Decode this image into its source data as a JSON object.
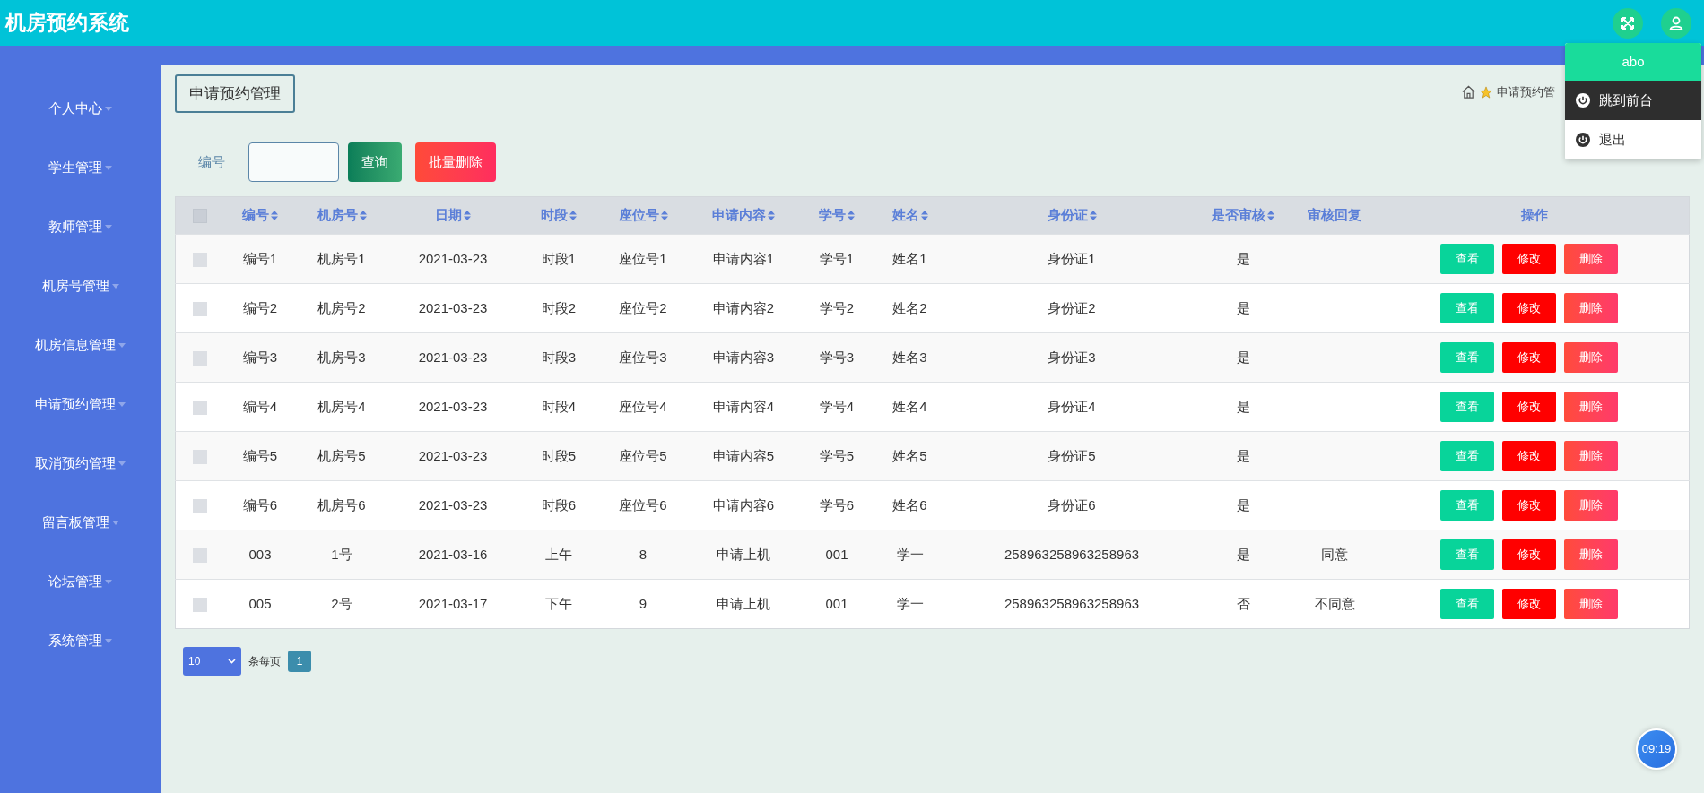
{
  "app_title": "机房预约系统",
  "user_menu": {
    "username": "abo",
    "items": [
      {
        "label": "跳到前台",
        "selected": true
      },
      {
        "label": "退出",
        "selected": false
      }
    ]
  },
  "sidebar": {
    "items": [
      "个人中心",
      "学生管理",
      "教师管理",
      "机房号管理",
      "机房信息管理",
      "申请预约管理",
      "取消预约管理",
      "留言板管理",
      "论坛管理",
      "系统管理"
    ]
  },
  "page_title": "申请预约管理",
  "breadcrumb": "申请预约管",
  "filter": {
    "label": "编号",
    "search_button": "查询",
    "batch_delete_button": "批量删除"
  },
  "table": {
    "select_all_checked": false,
    "columns": [
      {
        "label": "编号",
        "sortable": true
      },
      {
        "label": "机房号",
        "sortable": true
      },
      {
        "label": "日期",
        "sortable": true
      },
      {
        "label": "时段",
        "sortable": true
      },
      {
        "label": "座位号",
        "sortable": true
      },
      {
        "label": "申请内容",
        "sortable": true
      },
      {
        "label": "学号",
        "sortable": true
      },
      {
        "label": "姓名",
        "sortable": true
      },
      {
        "label": "身份证",
        "sortable": true
      },
      {
        "label": "是否审核",
        "sortable": true
      },
      {
        "label": "审核回复",
        "sortable": false
      },
      {
        "label": "操作",
        "sortable": false
      }
    ],
    "rows": [
      {
        "checked": false,
        "cells": [
          "编号1",
          "机房号1",
          "2021-03-23",
          "时段1",
          "座位号1",
          "申请内容1",
          "学号1",
          "姓名1",
          "身份证1",
          "是",
          ""
        ]
      },
      {
        "checked": false,
        "cells": [
          "编号2",
          "机房号2",
          "2021-03-23",
          "时段2",
          "座位号2",
          "申请内容2",
          "学号2",
          "姓名2",
          "身份证2",
          "是",
          ""
        ]
      },
      {
        "checked": false,
        "cells": [
          "编号3",
          "机房号3",
          "2021-03-23",
          "时段3",
          "座位号3",
          "申请内容3",
          "学号3",
          "姓名3",
          "身份证3",
          "是",
          ""
        ]
      },
      {
        "checked": false,
        "cells": [
          "编号4",
          "机房号4",
          "2021-03-23",
          "时段4",
          "座位号4",
          "申请内容4",
          "学号4",
          "姓名4",
          "身份证4",
          "是",
          ""
        ]
      },
      {
        "checked": false,
        "cells": [
          "编号5",
          "机房号5",
          "2021-03-23",
          "时段5",
          "座位号5",
          "申请内容5",
          "学号5",
          "姓名5",
          "身份证5",
          "是",
          ""
        ]
      },
      {
        "checked": false,
        "cells": [
          "编号6",
          "机房号6",
          "2021-03-23",
          "时段6",
          "座位号6",
          "申请内容6",
          "学号6",
          "姓名6",
          "身份证6",
          "是",
          ""
        ]
      },
      {
        "checked": false,
        "cells": [
          "003",
          "1号",
          "2021-03-16",
          "上午",
          "8",
          "申请上机",
          "001",
          "学一",
          "258963258963258963",
          "是",
          "同意"
        ]
      },
      {
        "checked": false,
        "cells": [
          "005",
          "2号",
          "2021-03-17",
          "下午",
          "9",
          "申请上机",
          "001",
          "学一",
          "258963258963258963",
          "否",
          "不同意"
        ]
      }
    ],
    "actions": [
      [
        "查看",
        "修改",
        "删除"
      ],
      [
        "查看",
        "修改",
        "删除"
      ],
      [
        "查看",
        "修改",
        "删除"
      ],
      [
        "查看",
        "修改",
        "删除"
      ],
      [
        "查看",
        "修改",
        "删除"
      ],
      [
        "查看",
        "修改",
        "删除"
      ],
      [
        "查看",
        "修改",
        "删除"
      ],
      [
        "查看",
        "修改",
        "删除"
      ]
    ]
  },
  "pagination": {
    "page_size": "10",
    "page_size_label": "条每页",
    "pages": [
      {
        "label": "1",
        "selected": true
      }
    ]
  },
  "clock": "09:19"
}
